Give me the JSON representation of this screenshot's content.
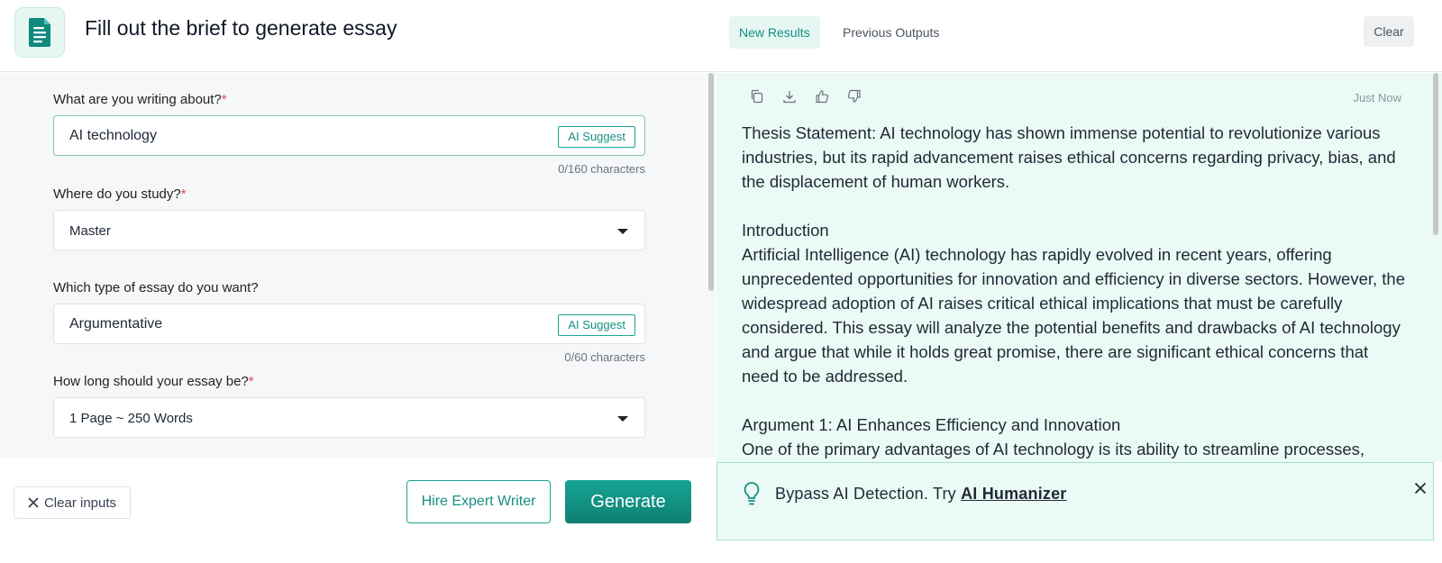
{
  "header": {
    "title": "Fill out the brief to generate essay",
    "logo_icon": "document-icon",
    "accent_color": "#158f80"
  },
  "form": {
    "topic": {
      "label": "What are you writing about?",
      "required_mark": "*",
      "value": "AI technology",
      "suggest_label": "AI Suggest",
      "char_count": "0/160 characters"
    },
    "study": {
      "label": "Where do you study?",
      "required_mark": "*",
      "value": "Master"
    },
    "essay_type": {
      "label": "Which type of essay do you want?",
      "value": "Argumentative",
      "suggest_label": "AI Suggest",
      "char_count": "0/60 characters"
    },
    "length": {
      "label": "How long should your essay be?",
      "required_mark": "*",
      "value": "1 Page ~ 250 Words"
    }
  },
  "footer": {
    "clear_inputs_label": "Clear inputs",
    "hire_label": "Hire Expert Writer",
    "generate_label": "Generate"
  },
  "results": {
    "tabs": [
      {
        "label": "New Results",
        "active": true
      },
      {
        "label": "Previous Outputs",
        "active": false
      }
    ],
    "clear_label": "Clear",
    "action_icons": [
      "copy-icon",
      "download-icon",
      "thumbs-up-icon",
      "thumbs-down-icon"
    ],
    "timestamp": "Just Now",
    "essay": {
      "thesis": "Thesis Statement: AI technology has shown immense potential to revolutionize various industries, but its rapid advancement raises ethical concerns regarding privacy, bias, and the displacement of human workers.",
      "intro_heading": "Introduction",
      "intro_body": "Artificial Intelligence (AI) technology has rapidly evolved in recent years, offering unprecedented opportunities for innovation and efficiency in diverse sectors. However, the widespread adoption of AI raises critical ethical implications that must be carefully considered. This essay will analyze the potential benefits and drawbacks of AI technology and argue that while it holds great promise, there are significant ethical concerns that need to be addressed.",
      "arg1_heading": "Argument 1: AI Enhances Efficiency and Innovation",
      "arg1_body": "One of the primary advantages of AI technology is its ability to streamline processes,"
    }
  },
  "banner": {
    "text": "Bypass AI Detection. Try ",
    "link_label": "AI Humanizer"
  }
}
